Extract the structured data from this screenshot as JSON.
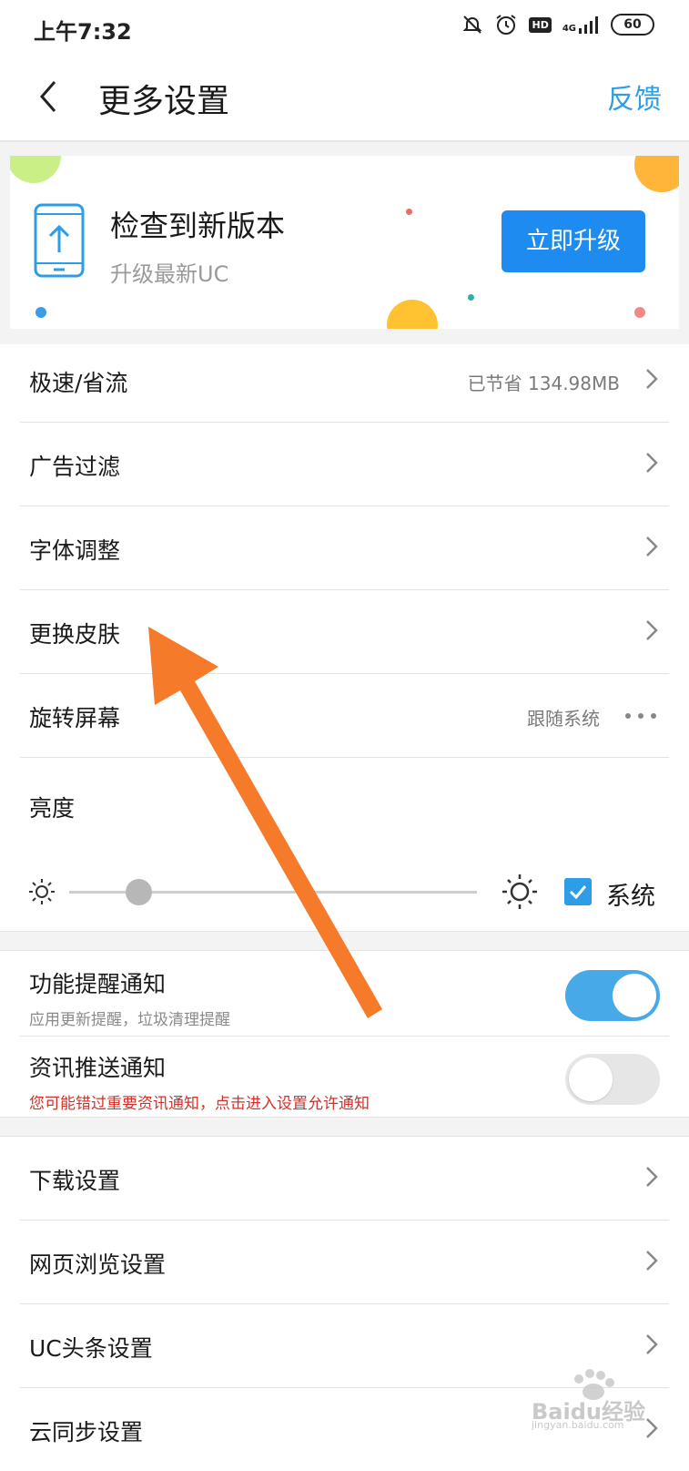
{
  "status_bar": {
    "time": "上午7:32",
    "hd": "HD",
    "network": "4G",
    "battery": "60"
  },
  "header": {
    "title": "更多设置",
    "feedback_label": "反馈"
  },
  "banner": {
    "title": "检查到新版本",
    "subtitle": "升级最新UC",
    "button_label": "立即升级"
  },
  "settings_group1": [
    {
      "label": "极速/省流",
      "value": "已节省 134.98MB"
    },
    {
      "label": "广告过滤",
      "value": ""
    },
    {
      "label": "字体调整",
      "value": ""
    },
    {
      "label": "更换皮肤",
      "value": ""
    },
    {
      "label": "旋转屏幕",
      "value": "跟随系统"
    }
  ],
  "brightness": {
    "label": "亮度",
    "level": 0.17,
    "system_label": "系统",
    "system_checked": true
  },
  "notifications": [
    {
      "title": "功能提醒通知",
      "subtitle": "应用更新提醒，垃圾清理提醒",
      "enabled": true
    },
    {
      "title": "资讯推送通知",
      "subtitle": "您可能错过重要资讯通知，点击进入设置允许通知",
      "enabled": false
    }
  ],
  "settings_group2": [
    {
      "label": "下载设置"
    },
    {
      "label": "网页浏览设置"
    },
    {
      "label": "UC头条设置"
    },
    {
      "label": "云同步设置"
    }
  ],
  "colors": {
    "accent_blue": "#2d9de5",
    "button_blue": "#1e8bf0",
    "warning_red": "#d2312a",
    "arrow_orange": "#f57a2a"
  },
  "watermark": {
    "text": "Baidu经验",
    "subtext": "jingyan.baidu.com"
  }
}
